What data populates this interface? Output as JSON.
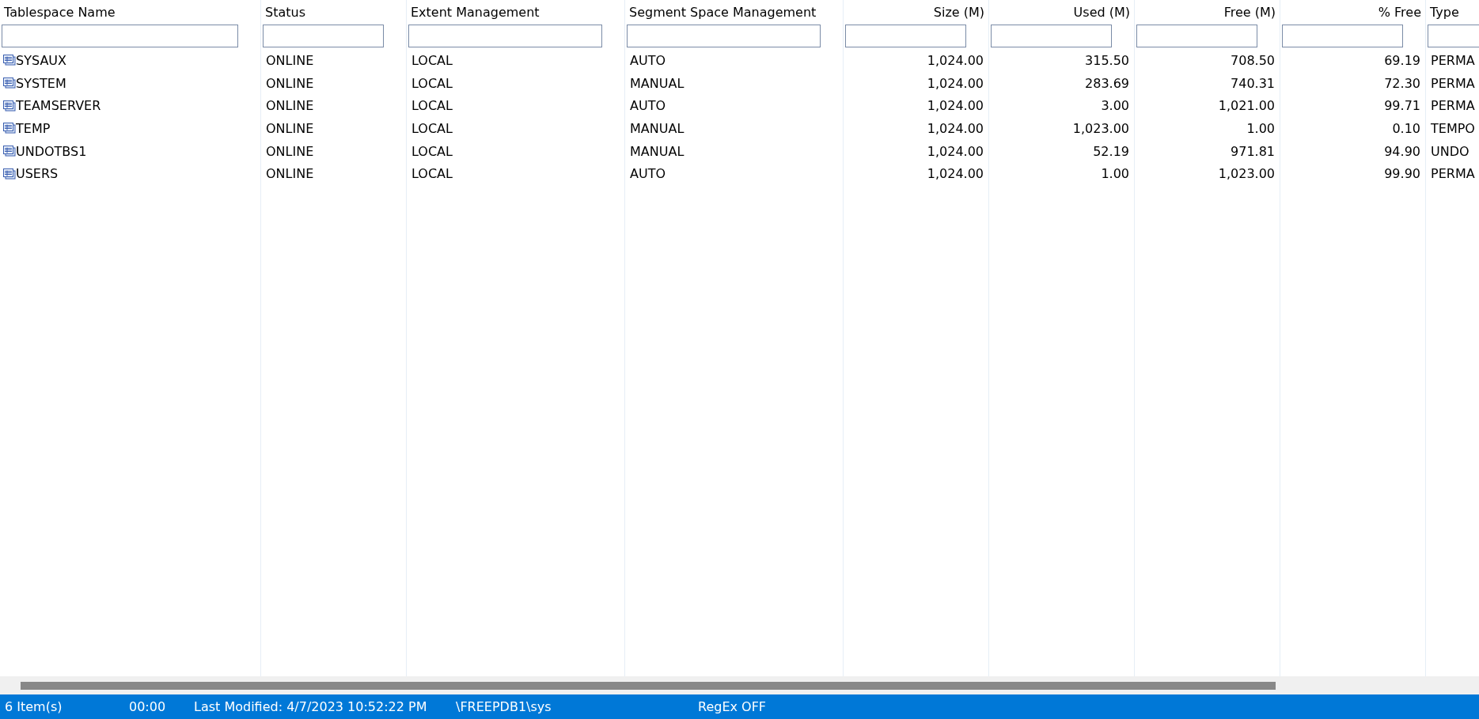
{
  "table": {
    "columns": [
      {
        "label": "Tablespace Name",
        "kind": "text"
      },
      {
        "label": "Status",
        "kind": "text"
      },
      {
        "label": "Extent Management",
        "kind": "text"
      },
      {
        "label": "Segment Space Management",
        "kind": "text"
      },
      {
        "label": "Size (M)",
        "kind": "number"
      },
      {
        "label": "Used (M)",
        "kind": "number"
      },
      {
        "label": "Free (M)",
        "kind": "number"
      },
      {
        "label": "% Free",
        "kind": "number"
      },
      {
        "label": "Type",
        "kind": "text"
      }
    ],
    "rows": [
      [
        "SYSAUX",
        "ONLINE",
        "LOCAL",
        "AUTO",
        "1,024.00",
        "315.50",
        "708.50",
        "69.19",
        "PERMA"
      ],
      [
        "SYSTEM",
        "ONLINE",
        "LOCAL",
        "MANUAL",
        "1,024.00",
        "283.69",
        "740.31",
        "72.30",
        "PERMA"
      ],
      [
        "TEAMSERVER",
        "ONLINE",
        "LOCAL",
        "AUTO",
        "1,024.00",
        "3.00",
        "1,021.00",
        "99.71",
        "PERMA"
      ],
      [
        "TEMP",
        "ONLINE",
        "LOCAL",
        "MANUAL",
        "1,024.00",
        "1,023.00",
        "1.00",
        "0.10",
        "TEMPO"
      ],
      [
        "UNDOTBS1",
        "ONLINE",
        "LOCAL",
        "MANUAL",
        "1,024.00",
        "52.19",
        "971.81",
        "94.90",
        "UNDO"
      ],
      [
        "USERS",
        "ONLINE",
        "LOCAL",
        "AUTO",
        "1,024.00",
        "1.00",
        "1,023.00",
        "99.90",
        "PERMA"
      ]
    ]
  },
  "status_bar": {
    "items": [
      "6 Item(s)",
      "00:00",
      "Last Modified: 4/7/2023 10:52:22 PM",
      "\\FREEPDB1\\sys",
      "RegEx OFF"
    ]
  }
}
